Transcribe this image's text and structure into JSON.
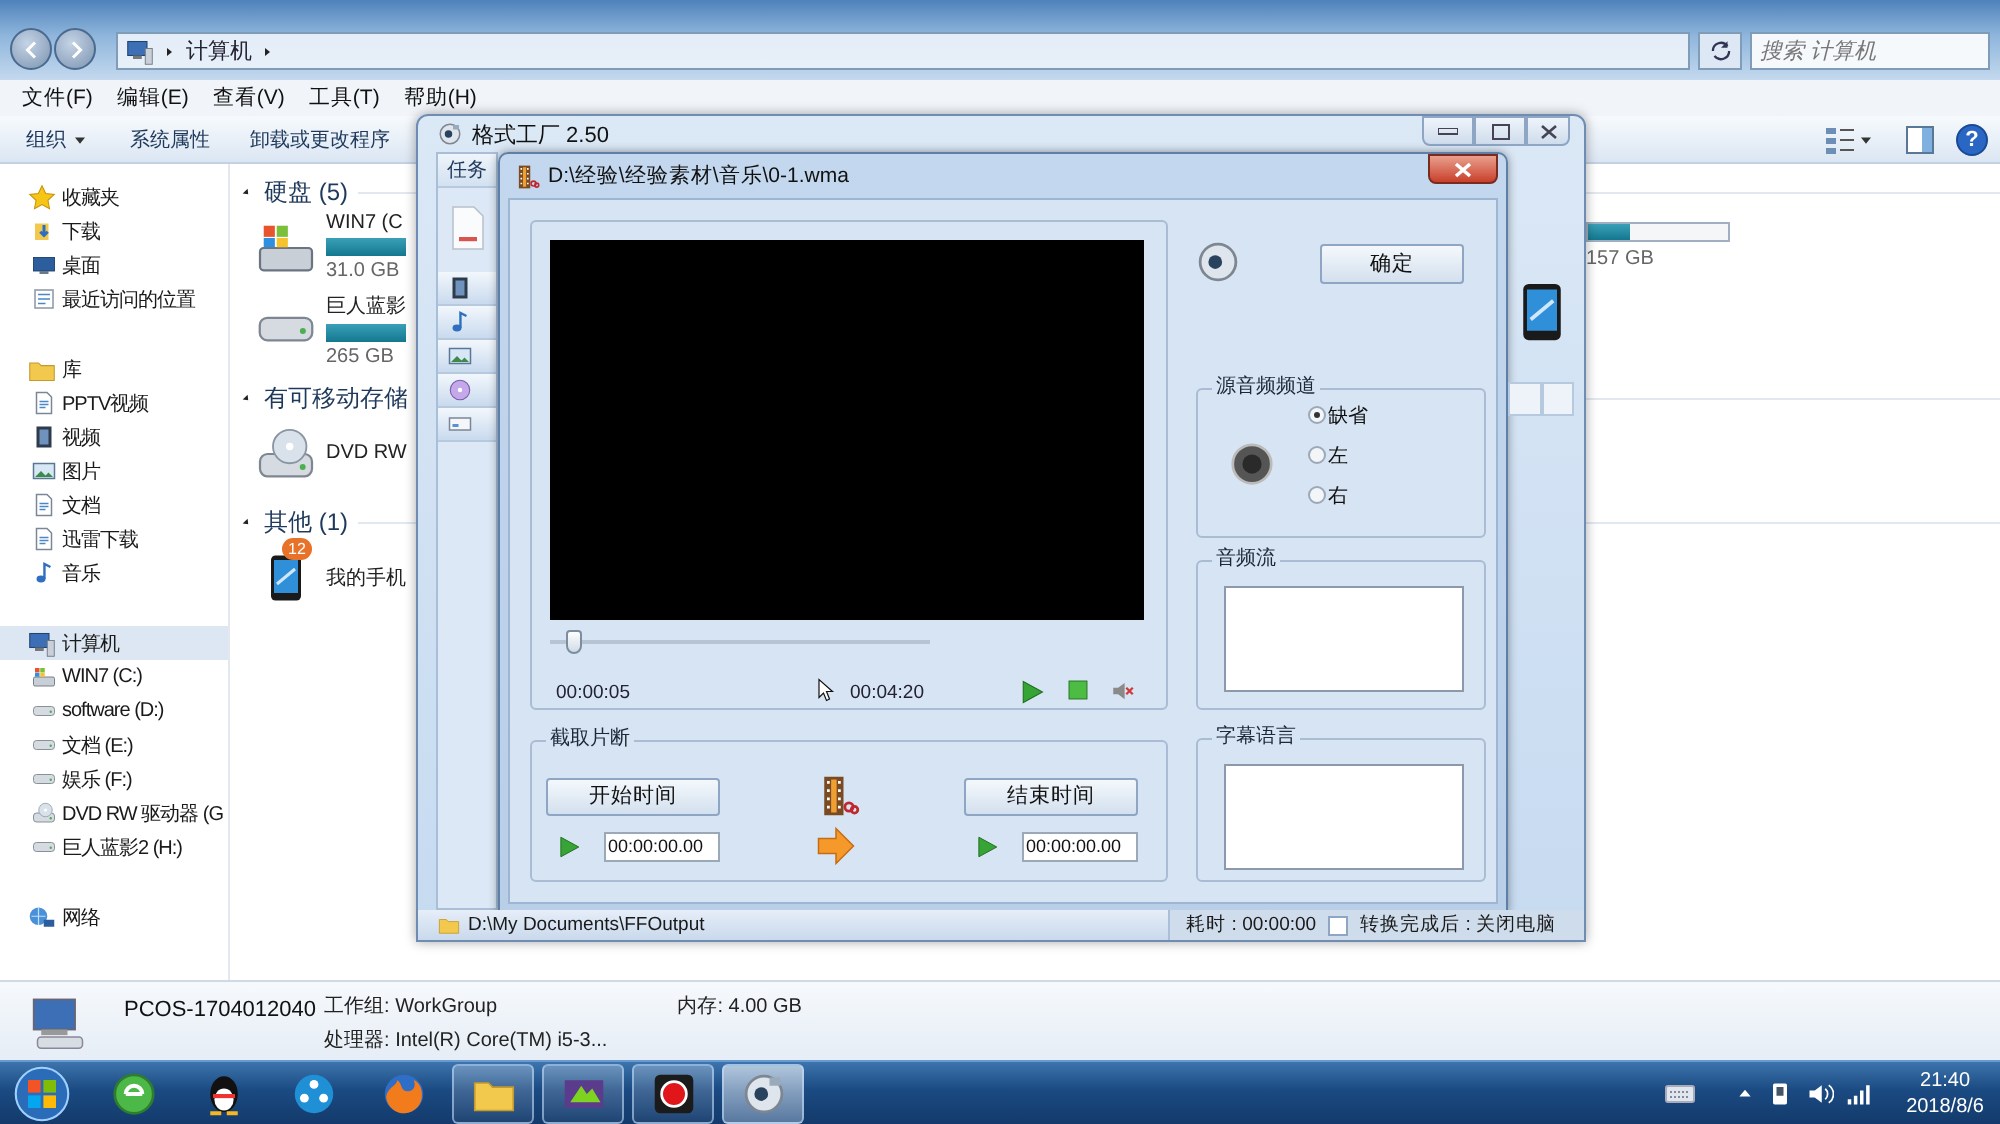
{
  "explorer": {
    "address": [
      "计算机"
    ],
    "search": {
      "placeholder": "搜索 计算机"
    },
    "menu": [
      "文件(F)",
      "编辑(E)",
      "查看(V)",
      "工具(T)",
      "帮助(H)"
    ],
    "toolbar": [
      {
        "label": "组织",
        "dropdown": true
      },
      {
        "label": "系统属性",
        "dropdown": false
      },
      {
        "label": "卸载或更改程序",
        "dropdown": false
      }
    ],
    "help": "?",
    "sidebar": [
      {
        "label": "收藏夹",
        "kind": "star",
        "selected": false,
        "children": [
          {
            "label": "下载",
            "kind": "download",
            "selected": false
          },
          {
            "label": "桌面",
            "kind": "desktop",
            "selected": false
          },
          {
            "label": "最近访问的位置",
            "kind": "recent",
            "selected": false
          }
        ]
      },
      {
        "label": "库",
        "kind": "folder",
        "selected": false,
        "children": [
          {
            "label": "PPTV视频",
            "kind": "doc",
            "selected": false
          },
          {
            "label": "视频",
            "kind": "video",
            "selected": false
          },
          {
            "label": "图片",
            "kind": "picture",
            "selected": false
          },
          {
            "label": "文档",
            "kind": "doc",
            "selected": false
          },
          {
            "label": "迅雷下载",
            "kind": "doc",
            "selected": false
          },
          {
            "label": "音乐",
            "kind": "music",
            "selected": false
          }
        ]
      },
      {
        "label": "计算机",
        "kind": "computer",
        "selected": true,
        "children": [
          {
            "label": "WIN7 (C:)",
            "kind": "win-drive",
            "selected": false
          },
          {
            "label": "software (D:)",
            "kind": "drive",
            "selected": false
          },
          {
            "label": "文档 (E:)",
            "kind": "drive",
            "selected": false
          },
          {
            "label": "娱乐 (F:)",
            "kind": "drive",
            "selected": false
          },
          {
            "label": "DVD RW 驱动器 (G",
            "kind": "dvd",
            "selected": false
          },
          {
            "label": "巨人蓝影2 (H:)",
            "kind": "drive",
            "selected": false
          }
        ]
      },
      {
        "label": "网络",
        "kind": "network",
        "selected": false
      }
    ],
    "sections": [
      {
        "title": "硬盘 (5)",
        "items": [
          {
            "kind": "win-drive",
            "name": "WIN7 (C",
            "size": "31.0 GB"
          },
          {
            "kind": "drive",
            "name": "巨人蓝影",
            "size": "265 GB"
          }
        ]
      },
      {
        "title": "有可移动存储",
        "items": [
          {
            "kind": "dvd",
            "name": "DVD RW"
          }
        ]
      },
      {
        "title": "其他 (1)",
        "items": [
          {
            "kind": "phone",
            "name": "我的手机",
            "badge": "12"
          }
        ]
      }
    ],
    "right_drive": {
      "level": 0.3,
      "size": "157 GB"
    },
    "details": {
      "name": "PCOS-1704012040",
      "fields": [
        {
          "label": "工作组:",
          "value": "WorkGroup"
        },
        {
          "label": "内存:",
          "value": "4.00 GB"
        },
        {
          "label": "处理器:",
          "value": "Intel(R) Core(TM) i5-3..."
        }
      ]
    }
  },
  "format_factory": {
    "title": "格式工厂 2.50",
    "task_tab": "任务",
    "categories": [
      {
        "kind": "video"
      },
      {
        "kind": "music"
      },
      {
        "kind": "picture"
      },
      {
        "kind": "disc"
      },
      {
        "kind": "other"
      }
    ],
    "output_path": "D:\\My Documents\\FFOutput",
    "elapsed": "耗时 : 00:00:00",
    "shutdown": {
      "label": "转换完成后 : 关闭电脑",
      "checked": false
    }
  },
  "dialog": {
    "title": "D:\\经验\\经验素材\\音乐\\0-1.wma",
    "player": {
      "level": 0.04,
      "current": "00:00:05",
      "total": "00:04:20"
    },
    "ok": "确定",
    "clip": {
      "title": "截取片断",
      "start_button": "开始时间",
      "end_button": "结束时间",
      "start_value": "00:00:00.00",
      "end_value": "00:00:00.00"
    },
    "channel": {
      "title": "源音频频道",
      "options": [
        {
          "label": "缺省",
          "selected": true
        },
        {
          "label": "左",
          "selected": false
        },
        {
          "label": "右",
          "selected": false
        }
      ]
    },
    "audio_stream": {
      "title": "音频流"
    },
    "subtitle": {
      "title": "字幕语言"
    }
  },
  "taskbar": {
    "apps": [
      {
        "kind": "ie",
        "running": false,
        "selected": false
      },
      {
        "kind": "qq",
        "running": false,
        "selected": false
      },
      {
        "kind": "player",
        "running": false,
        "selected": false
      },
      {
        "kind": "firefox",
        "running": false,
        "selected": false
      },
      {
        "kind": "folder",
        "running": true,
        "selected": false
      },
      {
        "kind": "media",
        "running": true,
        "selected": false
      },
      {
        "kind": "record",
        "running": true,
        "selected": false
      },
      {
        "kind": "ff",
        "running": true,
        "selected": true
      }
    ],
    "time": "21:40",
    "date": "2018/8/6"
  }
}
